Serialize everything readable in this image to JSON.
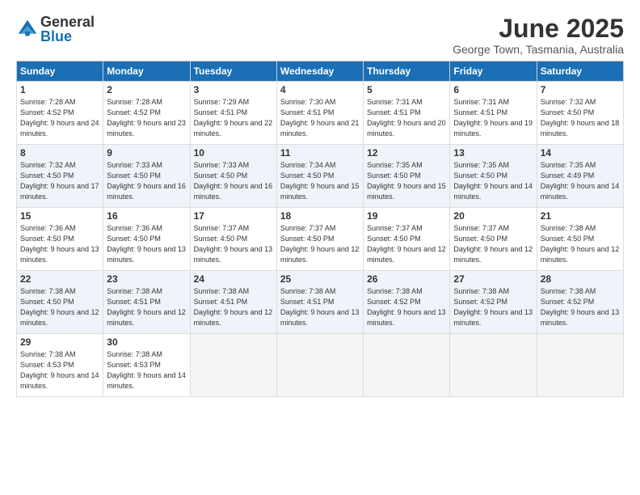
{
  "logo": {
    "general": "General",
    "blue": "Blue"
  },
  "title": {
    "month": "June 2025",
    "location": "George Town, Tasmania, Australia"
  },
  "headers": [
    "Sunday",
    "Monday",
    "Tuesday",
    "Wednesday",
    "Thursday",
    "Friday",
    "Saturday"
  ],
  "weeks": [
    [
      {
        "day": "1",
        "sunrise": "7:28 AM",
        "sunset": "4:52 PM",
        "daylight": "9 hours and 24 minutes."
      },
      {
        "day": "2",
        "sunrise": "7:28 AM",
        "sunset": "4:52 PM",
        "daylight": "9 hours and 23 minutes."
      },
      {
        "day": "3",
        "sunrise": "7:29 AM",
        "sunset": "4:51 PM",
        "daylight": "9 hours and 22 minutes."
      },
      {
        "day": "4",
        "sunrise": "7:30 AM",
        "sunset": "4:51 PM",
        "daylight": "9 hours and 21 minutes."
      },
      {
        "day": "5",
        "sunrise": "7:31 AM",
        "sunset": "4:51 PM",
        "daylight": "9 hours and 20 minutes."
      },
      {
        "day": "6",
        "sunrise": "7:31 AM",
        "sunset": "4:51 PM",
        "daylight": "9 hours and 19 minutes."
      },
      {
        "day": "7",
        "sunrise": "7:32 AM",
        "sunset": "4:50 PM",
        "daylight": "9 hours and 18 minutes."
      }
    ],
    [
      {
        "day": "8",
        "sunrise": "7:32 AM",
        "sunset": "4:50 PM",
        "daylight": "9 hours and 17 minutes."
      },
      {
        "day": "9",
        "sunrise": "7:33 AM",
        "sunset": "4:50 PM",
        "daylight": "9 hours and 16 minutes."
      },
      {
        "day": "10",
        "sunrise": "7:33 AM",
        "sunset": "4:50 PM",
        "daylight": "9 hours and 16 minutes."
      },
      {
        "day": "11",
        "sunrise": "7:34 AM",
        "sunset": "4:50 PM",
        "daylight": "9 hours and 15 minutes."
      },
      {
        "day": "12",
        "sunrise": "7:35 AM",
        "sunset": "4:50 PM",
        "daylight": "9 hours and 15 minutes."
      },
      {
        "day": "13",
        "sunrise": "7:35 AM",
        "sunset": "4:50 PM",
        "daylight": "9 hours and 14 minutes."
      },
      {
        "day": "14",
        "sunrise": "7:35 AM",
        "sunset": "4:49 PM",
        "daylight": "9 hours and 14 minutes."
      }
    ],
    [
      {
        "day": "15",
        "sunrise": "7:36 AM",
        "sunset": "4:50 PM",
        "daylight": "9 hours and 13 minutes."
      },
      {
        "day": "16",
        "sunrise": "7:36 AM",
        "sunset": "4:50 PM",
        "daylight": "9 hours and 13 minutes."
      },
      {
        "day": "17",
        "sunrise": "7:37 AM",
        "sunset": "4:50 PM",
        "daylight": "9 hours and 13 minutes."
      },
      {
        "day": "18",
        "sunrise": "7:37 AM",
        "sunset": "4:50 PM",
        "daylight": "9 hours and 12 minutes."
      },
      {
        "day": "19",
        "sunrise": "7:37 AM",
        "sunset": "4:50 PM",
        "daylight": "9 hours and 12 minutes."
      },
      {
        "day": "20",
        "sunrise": "7:37 AM",
        "sunset": "4:50 PM",
        "daylight": "9 hours and 12 minutes."
      },
      {
        "day": "21",
        "sunrise": "7:38 AM",
        "sunset": "4:50 PM",
        "daylight": "9 hours and 12 minutes."
      }
    ],
    [
      {
        "day": "22",
        "sunrise": "7:38 AM",
        "sunset": "4:50 PM",
        "daylight": "9 hours and 12 minutes."
      },
      {
        "day": "23",
        "sunrise": "7:38 AM",
        "sunset": "4:51 PM",
        "daylight": "9 hours and 12 minutes."
      },
      {
        "day": "24",
        "sunrise": "7:38 AM",
        "sunset": "4:51 PM",
        "daylight": "9 hours and 12 minutes."
      },
      {
        "day": "25",
        "sunrise": "7:38 AM",
        "sunset": "4:51 PM",
        "daylight": "9 hours and 13 minutes."
      },
      {
        "day": "26",
        "sunrise": "7:38 AM",
        "sunset": "4:52 PM",
        "daylight": "9 hours and 13 minutes."
      },
      {
        "day": "27",
        "sunrise": "7:38 AM",
        "sunset": "4:52 PM",
        "daylight": "9 hours and 13 minutes."
      },
      {
        "day": "28",
        "sunrise": "7:38 AM",
        "sunset": "4:52 PM",
        "daylight": "9 hours and 13 minutes."
      }
    ],
    [
      {
        "day": "29",
        "sunrise": "7:38 AM",
        "sunset": "4:53 PM",
        "daylight": "9 hours and 14 minutes."
      },
      {
        "day": "30",
        "sunrise": "7:38 AM",
        "sunset": "4:53 PM",
        "daylight": "9 hours and 14 minutes."
      },
      null,
      null,
      null,
      null,
      null
    ]
  ]
}
